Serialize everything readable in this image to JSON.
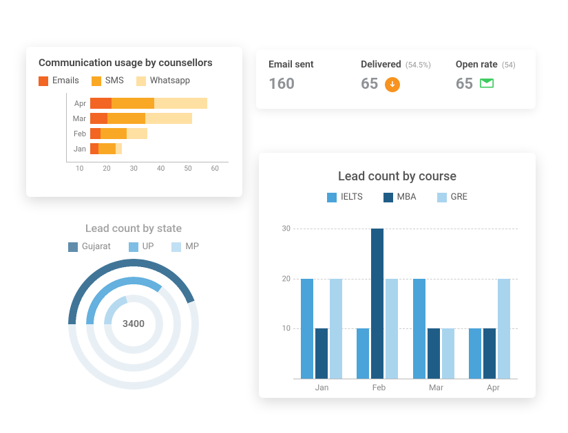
{
  "colors": {
    "emails": "#f26522",
    "sms": "#f9a825",
    "whatsapp": "#ffe0a3",
    "ielts": "#4aa3d9",
    "mba": "#1f5d87",
    "gre": "#a9d4ee",
    "gujarat": "#1f5d87",
    "up": "#4aa3d9",
    "mp": "#a9d4ee"
  },
  "comm": {
    "title": "Communication usage by counsellors",
    "legend": [
      "Emails",
      "SMS",
      "Whatsapp"
    ]
  },
  "emailStats": {
    "sent": {
      "label": "Email sent",
      "value": "160",
      "sub": ""
    },
    "delivered": {
      "label": "Delivered",
      "value": "65",
      "sub": "(54.5%)"
    },
    "open": {
      "label": "Open rate",
      "value": "65",
      "sub": "(54)"
    }
  },
  "course": {
    "title": "Lead count by course",
    "legend": [
      "IELTS",
      "MBA",
      "GRE"
    ]
  },
  "state": {
    "title": "Lead count by state",
    "legend": [
      "Gujarat",
      "UP",
      "MP"
    ],
    "center": "3400"
  },
  "chart_data": [
    {
      "id": "communication_usage",
      "type": "bar",
      "orientation": "horizontal",
      "stacked": true,
      "categories": [
        "Apr",
        "Mar",
        "Feb",
        "Jan"
      ],
      "series": [
        {
          "name": "Emails",
          "values": [
            10,
            8,
            5,
            4
          ]
        },
        {
          "name": "SMS",
          "values": [
            20,
            18,
            12,
            8
          ]
        },
        {
          "name": "Whatsapp",
          "values": [
            25,
            22,
            10,
            3
          ]
        }
      ],
      "x_ticks": [
        10,
        20,
        30,
        40,
        50,
        60
      ],
      "xlim": [
        0,
        65
      ],
      "title": "Communication usage by counsellors"
    },
    {
      "id": "lead_count_by_course",
      "type": "bar",
      "orientation": "vertical",
      "stacked": false,
      "categories": [
        "Jan",
        "Feb",
        "Mar",
        "Apr"
      ],
      "series": [
        {
          "name": "IELTS",
          "values": [
            20,
            10,
            20,
            10
          ]
        },
        {
          "name": "MBA",
          "values": [
            10,
            30,
            10,
            10
          ]
        },
        {
          "name": "GRE",
          "values": [
            20,
            20,
            10,
            20
          ]
        }
      ],
      "y_ticks": [
        10,
        20,
        30
      ],
      "ylim": [
        0,
        33
      ],
      "title": "Lead count by course"
    },
    {
      "id": "lead_count_by_state",
      "type": "radial",
      "series": [
        {
          "name": "Gujarat",
          "value": 1500
        },
        {
          "name": "UP",
          "value": 1200
        },
        {
          "name": "MP",
          "value": 700
        }
      ],
      "total": 3400,
      "title": "Lead count by state"
    }
  ]
}
